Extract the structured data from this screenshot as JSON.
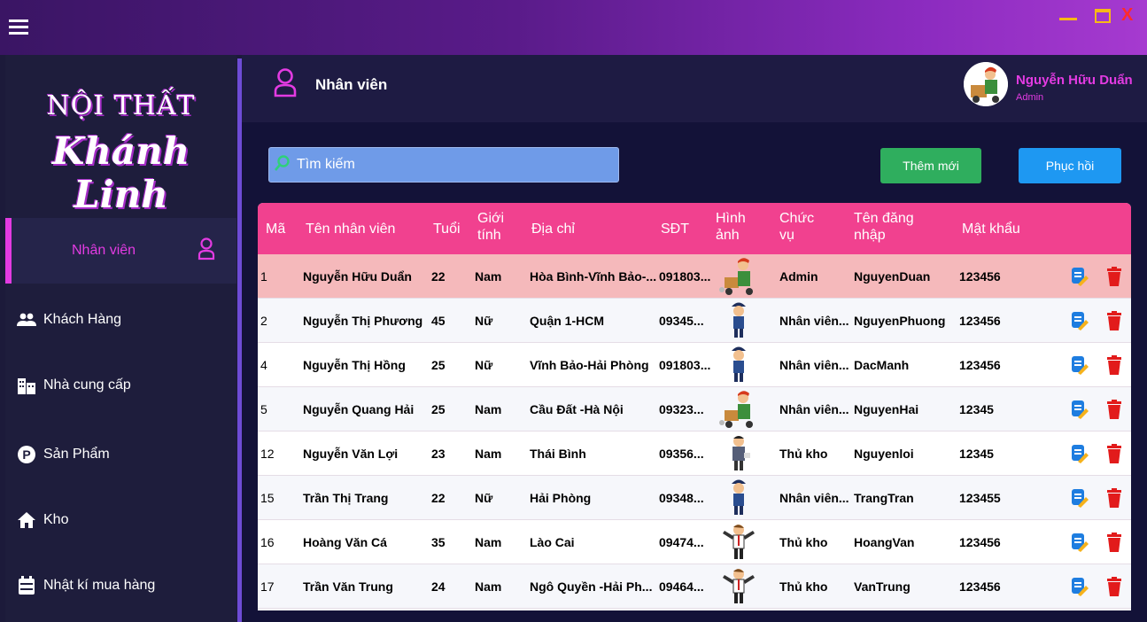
{
  "window": {
    "close_label": "X"
  },
  "brand": {
    "line1": "NỘI THẤT",
    "line2": "Khánh Linh"
  },
  "sidebar": {
    "active": {
      "label": "Nhân viên"
    },
    "items": [
      {
        "label": "Khách Hàng",
        "icon": "users-icon"
      },
      {
        "label": "Nhà cung cấp",
        "icon": "building-icon"
      },
      {
        "label": "Sản Phẩm",
        "icon": "product-p-icon"
      },
      {
        "label": "Kho",
        "icon": "home-icon"
      },
      {
        "label": "Nhật kí mua hàng",
        "icon": "calendar-icon"
      }
    ]
  },
  "header": {
    "title": "Nhân viên"
  },
  "user": {
    "name": "Nguyễn Hữu Duẩn",
    "role": "Admin"
  },
  "toolbar": {
    "search_placeholder": "Tìm kiếm",
    "add_label": "Thêm mới",
    "restore_label": "Phục hồi"
  },
  "table": {
    "columns": [
      "Mã",
      "Tên nhân viên",
      "Tuổi",
      "Giới tính",
      "Địa chỉ",
      "SĐT",
      "Hình ảnh",
      "Chức vụ",
      "Tên đăng nhập",
      "Mật khẩu"
    ],
    "rows": [
      {
        "id": "1",
        "name": "Nguyễn Hữu Duẩn",
        "age": "22",
        "gender": "Nam",
        "address": "Hòa Bình-Vĩnh Bảo-...",
        "phone": "091803...",
        "avatar": "delivery-icon",
        "role": "Admin",
        "username": "NguyenDuan",
        "password": "123456"
      },
      {
        "id": "2",
        "name": "Nguyễn Thị Phương",
        "age": "45",
        "gender": "Nữ",
        "address": "Quận 1-HCM",
        "phone": "09345...",
        "avatar": "police-icon",
        "role": "Nhân viên...",
        "username": "NguyenPhuong",
        "password": "123456"
      },
      {
        "id": "4",
        "name": "Nguyễn Thị Hồng",
        "age": "25",
        "gender": "Nữ",
        "address": "Vĩnh Bảo-Hải Phòng",
        "phone": "091803...",
        "avatar": "police-icon",
        "role": "Nhân viên...",
        "username": "DacManh",
        "password": "123456"
      },
      {
        "id": "5",
        "name": "Nguyễn Quang Hải",
        "age": "25",
        "gender": "Nam",
        "address": "Cầu Đất -Hà Nội",
        "phone": "09323...",
        "avatar": "delivery-icon",
        "role": "Nhân viên...",
        "username": "NguyenHai",
        "password": "12345"
      },
      {
        "id": "12",
        "name": "Nguyễn Văn Lợi",
        "age": "23",
        "gender": "Nam",
        "address": "Thái Bình",
        "phone": "09356...",
        "avatar": "officer-icon",
        "role": "Thủ kho",
        "username": "Nguyenloi",
        "password": "12345"
      },
      {
        "id": "15",
        "name": "Trần Thị Trang",
        "age": "22",
        "gender": "Nữ",
        "address": "Hải Phòng",
        "phone": "09348...",
        "avatar": "police-icon",
        "role": "Nhân viên...",
        "username": "TrangTran",
        "password": "123455"
      },
      {
        "id": "16",
        "name": "Hoàng Văn Cá",
        "age": "35",
        "gender": "Nam",
        "address": "Lào Cai",
        "phone": "09474...",
        "avatar": "businessman-icon",
        "role": "Thủ kho",
        "username": "HoangVan",
        "password": "123456"
      },
      {
        "id": "17",
        "name": "Trần Văn Trung",
        "age": "24",
        "gender": "Nam",
        "address": "Ngô Quyền -Hải Ph...",
        "phone": "09464...",
        "avatar": "businessman-icon",
        "role": "Thủ kho",
        "username": "VanTrung",
        "password": "123456"
      }
    ]
  },
  "colors": {
    "accent": "#e33be2",
    "header_row": "#f1418f",
    "selected_row": "#f5b9bb",
    "add": "#2fae5e",
    "restore": "#1e98f2"
  }
}
